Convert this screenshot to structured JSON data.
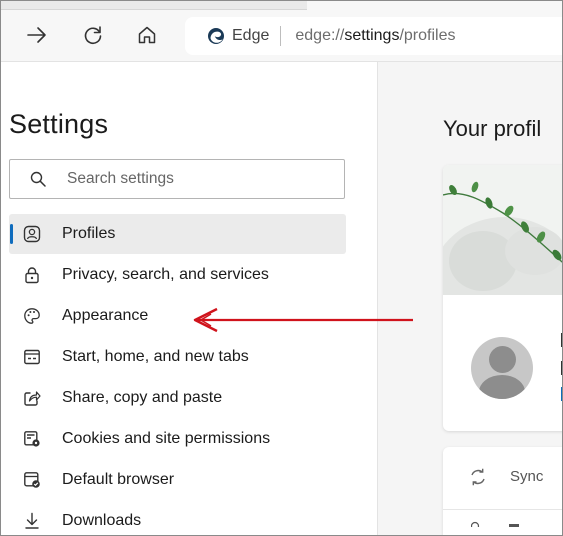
{
  "browser": {
    "site_name": "Edge",
    "url_prefix": "edge://",
    "url_highlight": "settings",
    "url_suffix": "/profiles"
  },
  "sidebar": {
    "title": "Settings",
    "search_placeholder": "Search settings",
    "items": [
      {
        "label": "Profiles",
        "icon": "profile-icon",
        "selected": true
      },
      {
        "label": "Privacy, search, and services",
        "icon": "lock-icon",
        "selected": false
      },
      {
        "label": "Appearance",
        "icon": "palette-icon",
        "selected": false
      },
      {
        "label": "Start, home, and new tabs",
        "icon": "new-tab-icon",
        "selected": false
      },
      {
        "label": "Share, copy and paste",
        "icon": "share-icon",
        "selected": false
      },
      {
        "label": "Cookies and site permissions",
        "icon": "cookies-icon",
        "selected": false
      },
      {
        "label": "Default browser",
        "icon": "default-browser-icon",
        "selected": false
      },
      {
        "label": "Downloads",
        "icon": "download-icon",
        "selected": false
      }
    ]
  },
  "main": {
    "heading": "Your profil",
    "sync_label": "Sync"
  },
  "colors": {
    "accent": "#0f6cbd",
    "annotation_arrow": "#d0131c"
  }
}
